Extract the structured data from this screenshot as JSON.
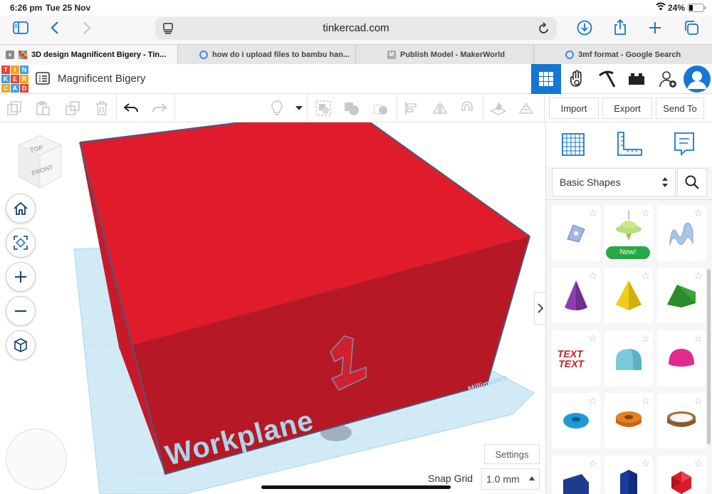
{
  "status": {
    "time": "6:26 pm",
    "date": "Tue 25 Nov",
    "battery": "24%"
  },
  "browser": {
    "address": "tinkercad.com",
    "tabs": [
      {
        "title": "3D design Magnificent Bigery - Tin...",
        "favicon": "tinkercad"
      },
      {
        "title": "how do i upload files to bambu han...",
        "favicon": "google"
      },
      {
        "title": "Publish Model - MakerWorld",
        "favicon": "makerworld"
      },
      {
        "title": "3mf format - Google Search",
        "favicon": "google"
      }
    ]
  },
  "app": {
    "logo_letters": [
      "T",
      "I",
      "N",
      "K",
      "E",
      "R",
      "C",
      "A",
      "D"
    ],
    "design_title": "Magnificent Bigery"
  },
  "toolbar": {
    "import_label": "Import",
    "export_label": "Export",
    "send_to_label": "Send To"
  },
  "viewport": {
    "view_cube_top": "TOP",
    "view_cube_front": "FRONT",
    "workplane_label": "Workplane",
    "units_label": "Millimeters",
    "settings_label": "Settings",
    "snap_grid_label": "Snap Grid",
    "snap_grid_value": "1.0 mm"
  },
  "panel": {
    "category": "Basic Shapes",
    "new_badge": "New!",
    "shapes": [
      {
        "name": "scribble-icon"
      },
      {
        "name": "spinning-top-icon"
      },
      {
        "name": "wavy-shape-icon"
      },
      {
        "name": "cone-icon"
      },
      {
        "name": "pyramid-icon"
      },
      {
        "name": "roof-icon"
      },
      {
        "name": "text-icon"
      },
      {
        "name": "half-cylinder-icon"
      },
      {
        "name": "half-sphere-icon"
      },
      {
        "name": "torus-icon"
      },
      {
        "name": "tube-icon"
      },
      {
        "name": "ring-icon"
      },
      {
        "name": "polygon-icon"
      },
      {
        "name": "hexagonal-prism-icon"
      },
      {
        "name": "icosahedron-icon"
      }
    ]
  },
  "colors": {
    "accent": "#1477d4",
    "box_top": "#e01b2b",
    "box_front": "#b71825",
    "workplane": "#cfe9f5",
    "badge": "#27a844"
  }
}
